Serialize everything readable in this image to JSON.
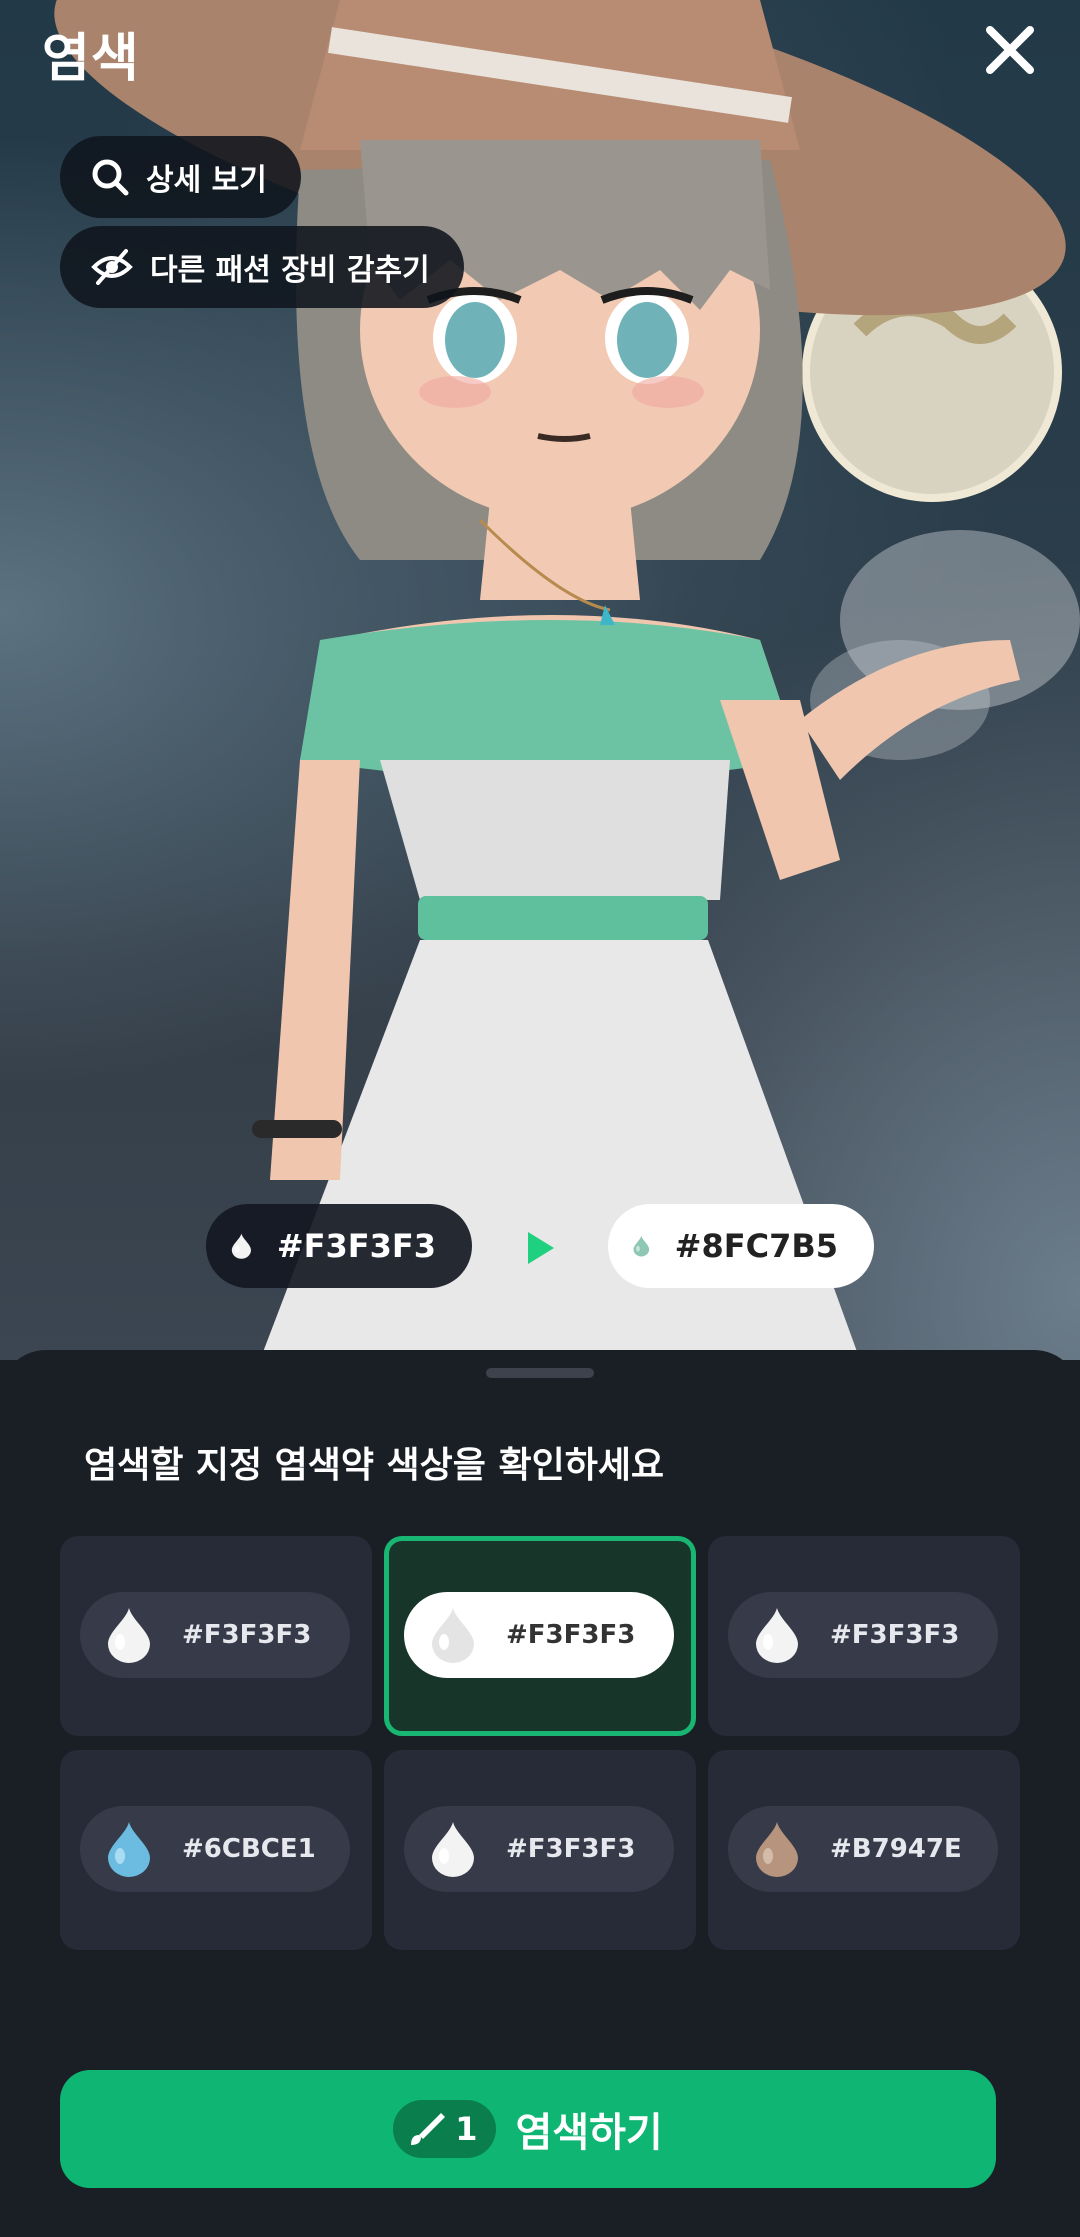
{
  "header": {
    "title": "염색"
  },
  "top_buttons": {
    "detail_label": "상세 보기",
    "hide_label": "다른 패션 장비 감추기"
  },
  "preview": {
    "from_hex": "#F3F3F3",
    "from_color": "#F3F3F3",
    "to_hex": "#8FC7B5",
    "to_color": "#8FC7B5",
    "arrow_color": "#1fd17f"
  },
  "sheet": {
    "title": "염색할 지정 염색약 색상을 확인하세요",
    "options": [
      {
        "hex": "#F3F3F3",
        "color": "#F3F3F3",
        "selected": false
      },
      {
        "hex": "#F3F3F3",
        "color": "#F3F3F3",
        "selected": true
      },
      {
        "hex": "#F3F3F3",
        "color": "#F3F3F3",
        "selected": false
      },
      {
        "hex": "#6CBCE1",
        "color": "#6CBCE1",
        "selected": false
      },
      {
        "hex": "#F3F3F3",
        "color": "#F3F3F3",
        "selected": false
      },
      {
        "hex": "#B7947E",
        "color": "#B7947E",
        "selected": false
      }
    ]
  },
  "action": {
    "count": "1",
    "label": "염색하기",
    "accent": "#0eb573"
  }
}
